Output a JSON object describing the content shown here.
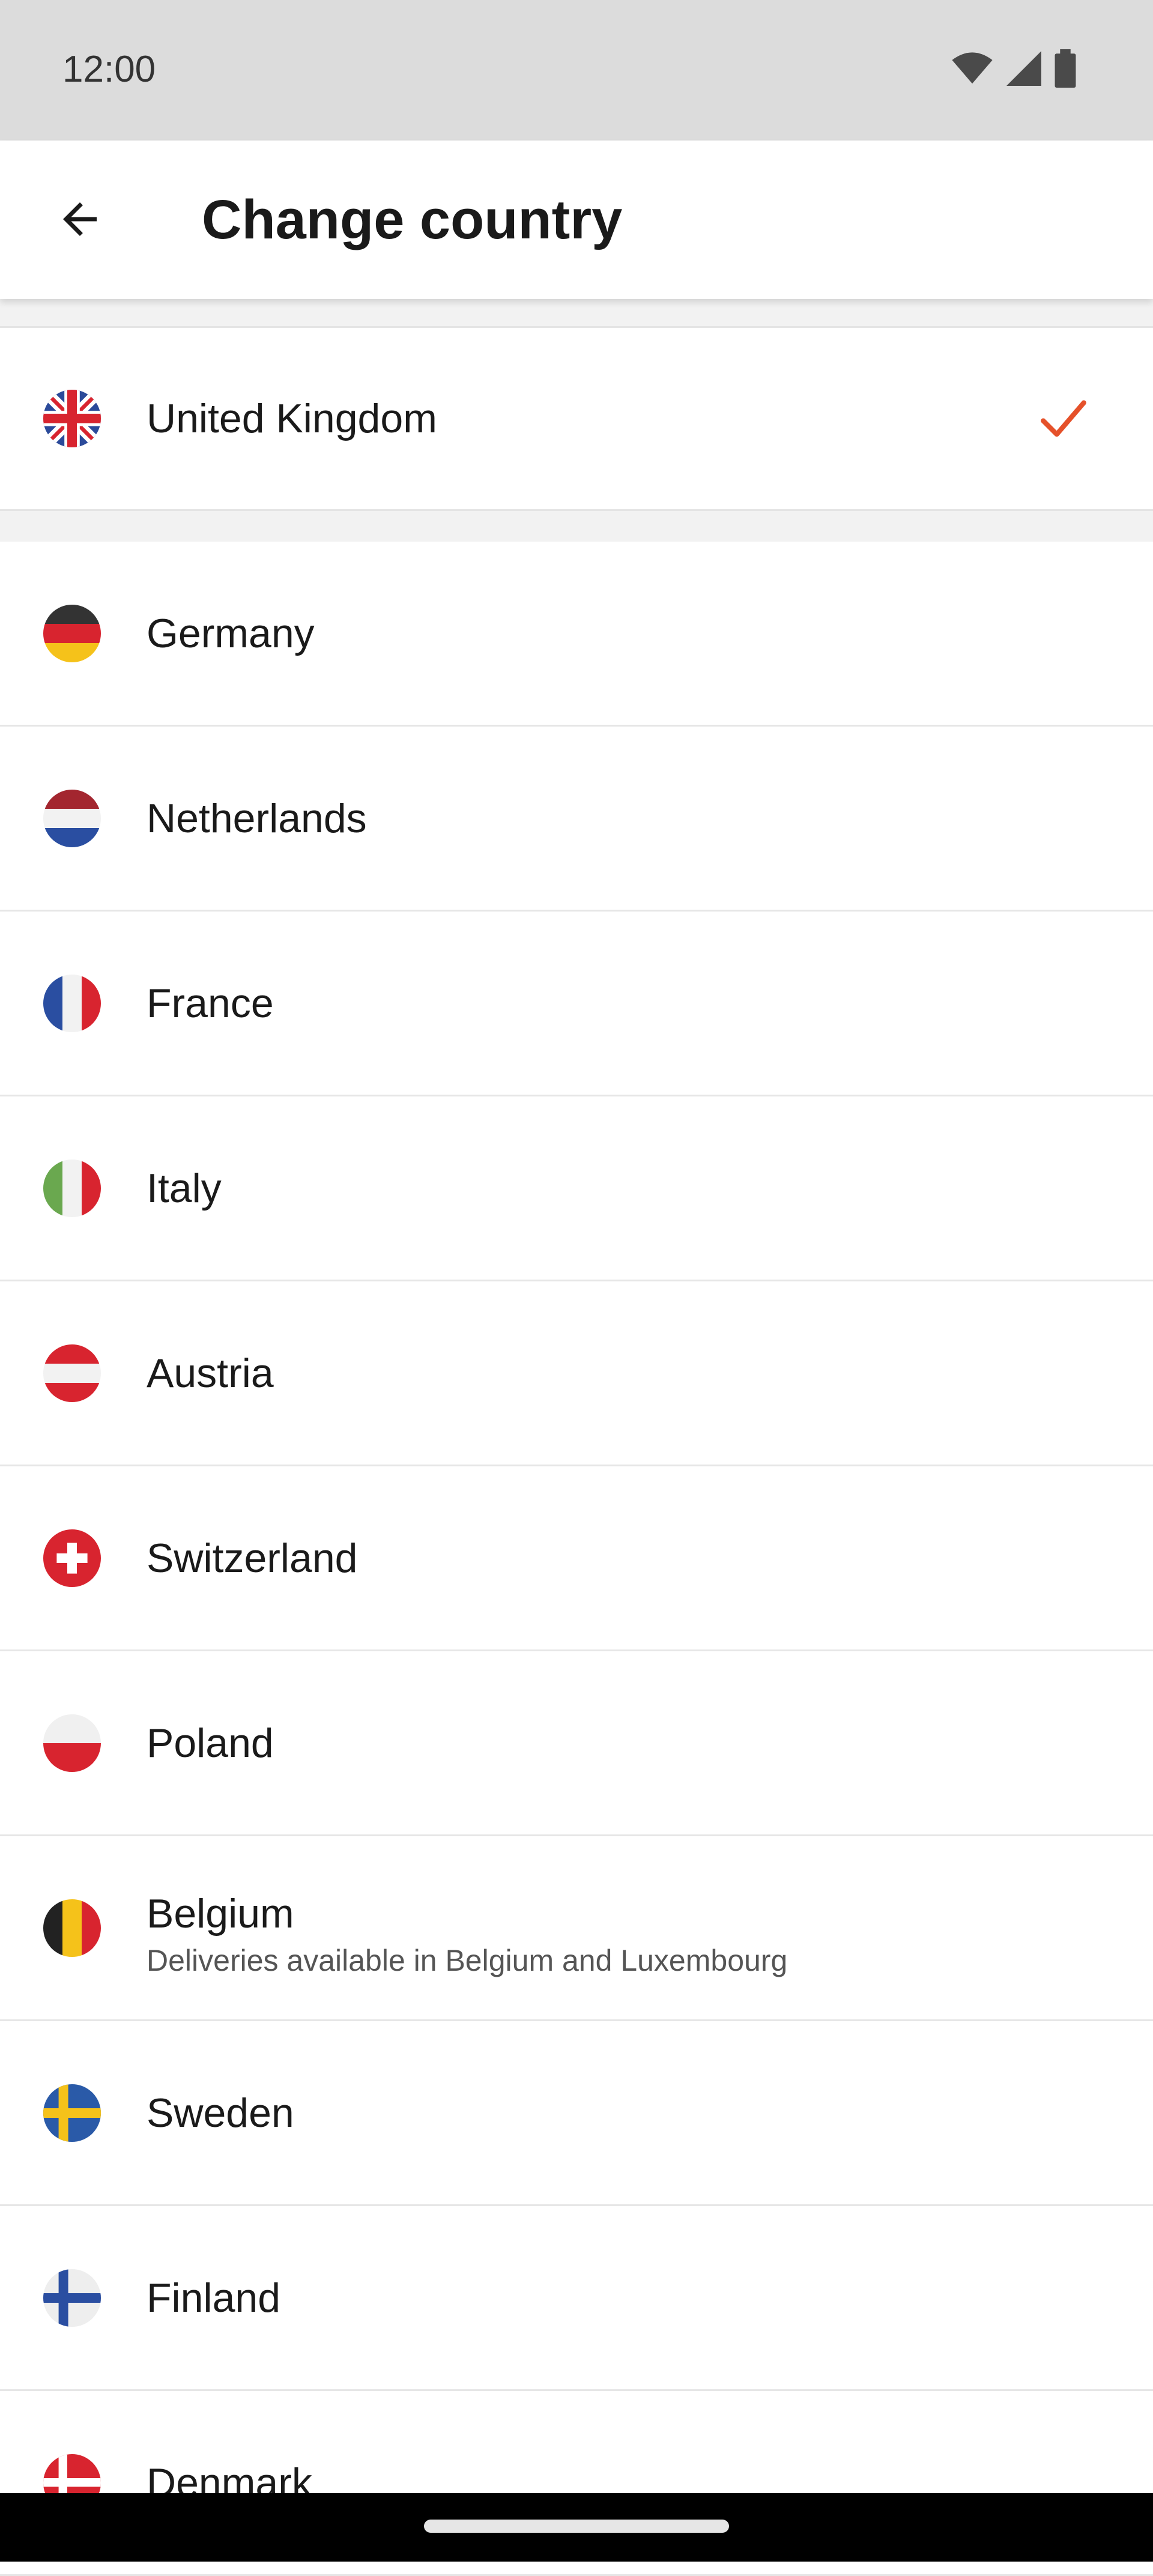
{
  "status_bar": {
    "time": "12:00"
  },
  "app_bar": {
    "title": "Change country"
  },
  "selected": {
    "label": "United Kingdom"
  },
  "countries": [
    {
      "label": "Germany"
    },
    {
      "label": "Netherlands"
    },
    {
      "label": "France"
    },
    {
      "label": "Italy"
    },
    {
      "label": "Austria"
    },
    {
      "label": "Switzerland"
    },
    {
      "label": "Poland"
    },
    {
      "label": "Belgium",
      "sub": "Deliveries available in Belgium and Luxembourg"
    },
    {
      "label": "Sweden"
    },
    {
      "label": "Finland"
    },
    {
      "label": "Denmark"
    }
  ],
  "colors": {
    "accent": "#e5512a",
    "divider": "#e6e6e6",
    "status_bar": "#dcdcdc"
  }
}
